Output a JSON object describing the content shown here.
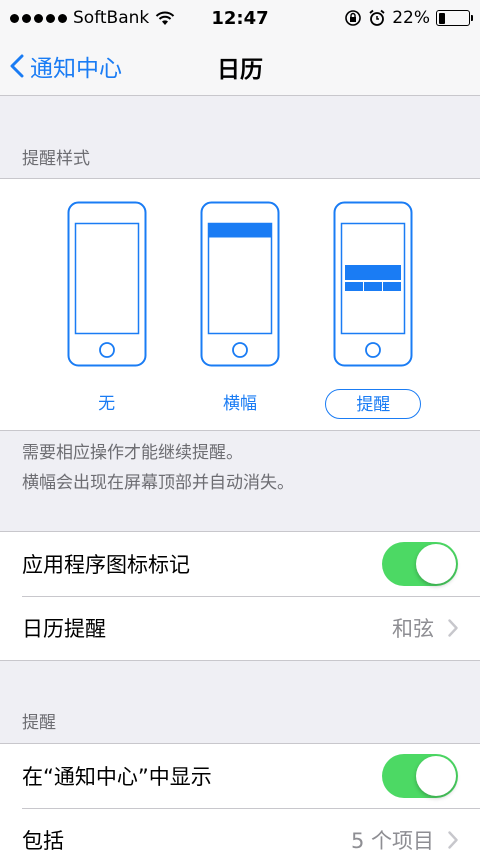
{
  "status_bar": {
    "carrier": "SoftBank",
    "time": "12:47",
    "battery_percent": "22%",
    "battery_level": 0.22
  },
  "nav": {
    "back_label": "通知中心",
    "title": "日历"
  },
  "alert_style": {
    "header": "提醒样式",
    "options": [
      {
        "label": "无",
        "type": "none",
        "selected": false
      },
      {
        "label": "横幅",
        "type": "banner",
        "selected": false
      },
      {
        "label": "提醒",
        "type": "alert",
        "selected": true
      }
    ],
    "footer_line1": "需要相应操作才能继续提醒。",
    "footer_line2": "横幅会出现在屏幕顶部并自动消失。"
  },
  "settings1": {
    "badge_label": "应用程序图标标记",
    "badge_on": true,
    "sound_label": "日历提醒",
    "sound_value": "和弦"
  },
  "reminders": {
    "header": "提醒",
    "show_in_nc_label": "在“通知中心”中显示",
    "show_in_nc_on": true,
    "include_label": "包括",
    "include_value": "5 个项目"
  },
  "colors": {
    "accent": "#1a7cf4",
    "toggle_on": "#4cd964",
    "background": "#efeff4"
  }
}
